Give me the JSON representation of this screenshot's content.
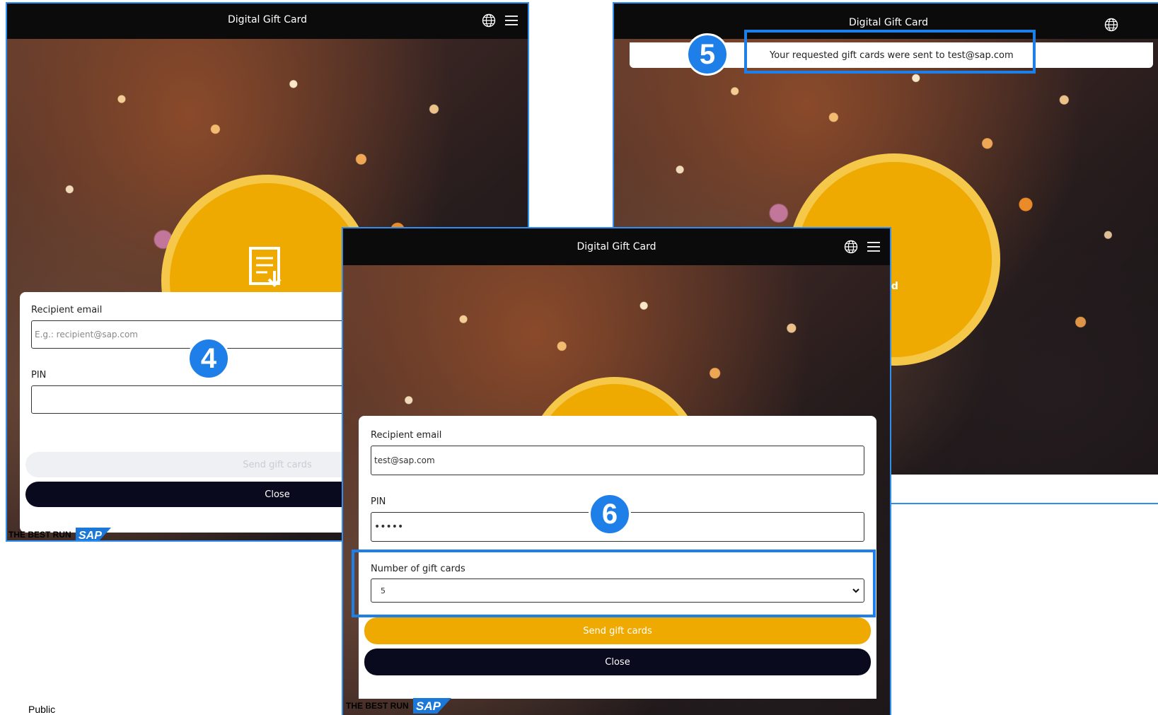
{
  "app_title": "Digital Gift Card",
  "footer_text": "Public",
  "sap_logo": {
    "tagline": "THE BEST RUN",
    "brand": "SAP"
  },
  "left_screen": {
    "recipient_label": "Recipient email",
    "recipient_placeholder": "E.g.: recipient@sap.com",
    "pin_label": "PIN",
    "pin_value": "",
    "send_label": "Send gift cards",
    "close_label": "Close"
  },
  "right_screen": {
    "notification": "Your requested gift cards were sent to test@sap.com",
    "download_label": "nload"
  },
  "center_screen": {
    "recipient_label": "Recipient email",
    "recipient_value": "test@sap.com",
    "pin_label": "PIN",
    "pin_value": "•••••",
    "count_label": "Number of gift cards",
    "count_value": "5",
    "send_label": "Send gift cards",
    "close_label": "Close"
  },
  "badges": {
    "step4": "4",
    "step5": "5",
    "step6": "6"
  },
  "colors": {
    "accent": "#eeaa00",
    "dark": "#0a0a1e",
    "highlight": "#1e7fe8"
  }
}
